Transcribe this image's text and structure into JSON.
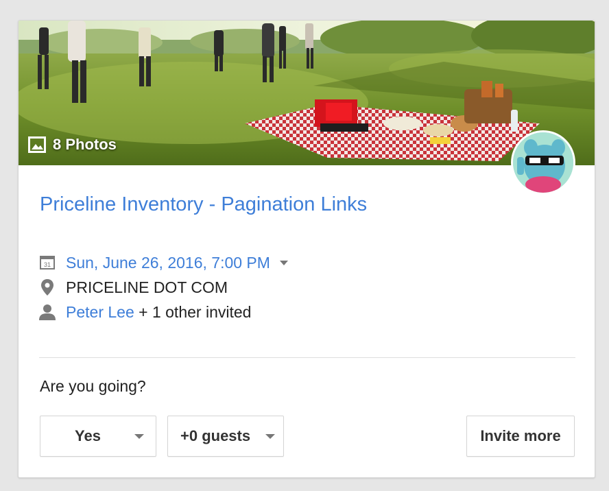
{
  "event": {
    "photos_label": "8 Photos",
    "title": "Priceline Inventory - Pagination Links",
    "datetime": "Sun, June 26, 2016, 7:00 PM",
    "location": "PRICELINE DOT COM",
    "host": "Peter Lee",
    "invited_suffix": " + 1 other invited"
  },
  "rsvp": {
    "question": "Are you going?",
    "response_label": "Yes",
    "guests_label": "+0 guests",
    "invite_label": "Invite more"
  },
  "icons": {
    "photos": "image-icon",
    "date": "calendar-icon",
    "location": "location-pin-icon",
    "people": "person-icon",
    "dropdown": "chevron-down-icon"
  },
  "colors": {
    "link": "#3e7ed8",
    "text": "#222222",
    "page_bg": "#e6e6e6"
  }
}
